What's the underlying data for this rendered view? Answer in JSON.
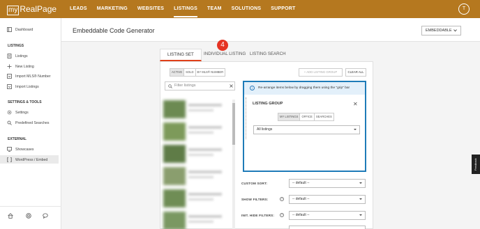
{
  "app": {
    "logo_my": "my",
    "logo_text": "RealPage",
    "avatar_initial": "T",
    "nav": [
      "LEADS",
      "MARKETING",
      "WEBSITES",
      "LISTINGS",
      "TEAM",
      "SOLUTIONS",
      "SUPPORT"
    ],
    "active_nav": "LISTINGS"
  },
  "sidebar": {
    "dashboard": "Dashboard",
    "listings_head": "LISTINGS",
    "listings": "Listings",
    "new_listing": "New Listing",
    "import_mls": "Import MLS® Number",
    "import_listings": "Import Listings",
    "settings_head": "SETTINGS & TOOLS",
    "settings": "Settings",
    "predefined": "Predefined Searches",
    "external_head": "EXTERNAL",
    "showcases": "Showcases",
    "wordpress": "WordPress / Embed"
  },
  "page": {
    "title": "Embeddable Code Generator",
    "embed_button": "EMBEDDABLE"
  },
  "tabs": [
    "LISTING SET",
    "INDIVIDUAL LISTING",
    "LISTING SEARCH"
  ],
  "step_badge": "4",
  "listing_set": {
    "filter_modes": [
      "ACTIVE",
      "SOLD",
      "BY MLS® NUMBER"
    ],
    "add_group": "+ ADD LISTING GROUP",
    "clear_all": "CLEAR ALL",
    "filter_placeholder": "Filter listings"
  },
  "group": {
    "info": "Re-arrange items below by dragging them using the \"grip\" bar",
    "title": "LISTING GROUP",
    "scope": [
      "MY LISTINGS",
      "OFFICE",
      "SEARCHES"
    ],
    "select_value": "All listings"
  },
  "fields": {
    "custom_sort": "CUSTOM SORT:",
    "show_filters": "SHOW FILTERS:",
    "init_hide_filters": "INIT. HIDE FILTERS:",
    "default_value": "-- default --"
  },
  "feedback": "Feedback",
  "colors": {
    "topbar": "#b5781f",
    "accent": "#e0401a",
    "info_border": "#1e7bb8"
  }
}
